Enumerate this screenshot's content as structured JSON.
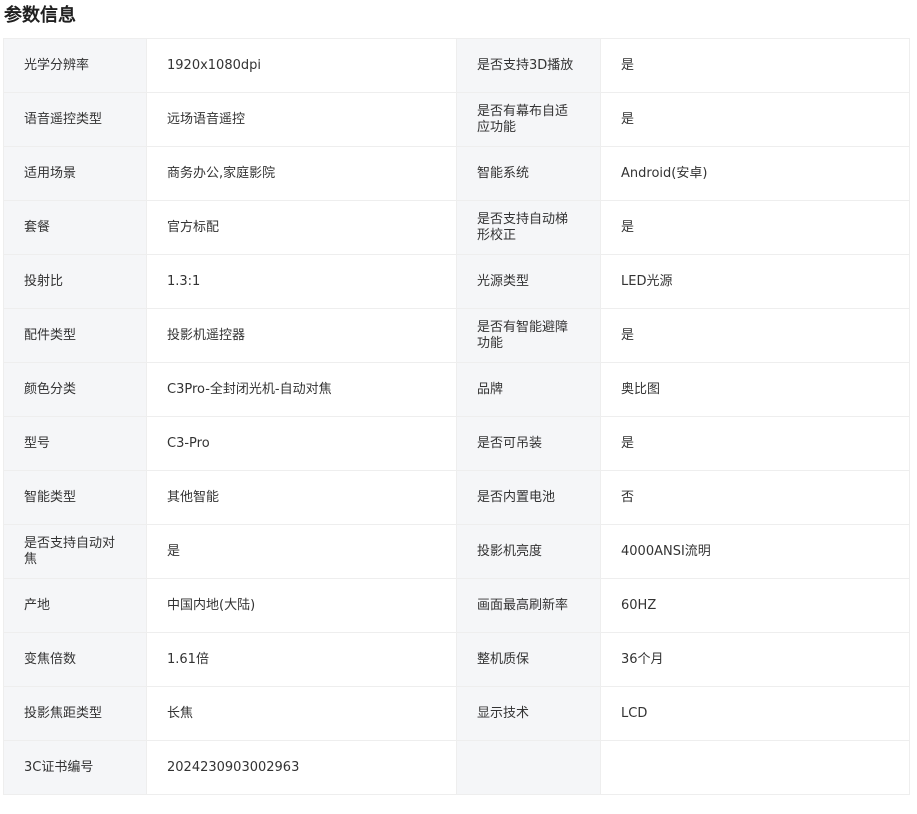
{
  "section": {
    "title": "参数信息"
  },
  "rows": [
    {
      "l_label": "光学分辨率",
      "l_value": "1920x1080dpi",
      "r_label": "是否支持3D播放",
      "r_value": "是"
    },
    {
      "l_label": "语音遥控类型",
      "l_value": "远场语音遥控",
      "r_label": "是否有幕布自适应功能",
      "r_value": "是"
    },
    {
      "l_label": "适用场景",
      "l_value": "商务办公,家庭影院",
      "r_label": "智能系统",
      "r_value": "Android(安卓)"
    },
    {
      "l_label": "套餐",
      "l_value": "官方标配",
      "r_label": "是否支持自动梯形校正",
      "r_value": "是"
    },
    {
      "l_label": "投射比",
      "l_value": "1.3:1",
      "r_label": "光源类型",
      "r_value": "LED光源"
    },
    {
      "l_label": "配件类型",
      "l_value": "投影机遥控器",
      "r_label": "是否有智能避障功能",
      "r_value": "是"
    },
    {
      "l_label": "颜色分类",
      "l_value": "C3Pro-全封闭光机-自动对焦",
      "r_label": "品牌",
      "r_value": "奥比图"
    },
    {
      "l_label": "型号",
      "l_value": "C3-Pro",
      "r_label": "是否可吊装",
      "r_value": "是"
    },
    {
      "l_label": "智能类型",
      "l_value": "其他智能",
      "r_label": "是否内置电池",
      "r_value": "否"
    },
    {
      "l_label": "是否支持自动对焦",
      "l_value": "是",
      "r_label": "投影机亮度",
      "r_value": "4000ANSI流明"
    },
    {
      "l_label": "产地",
      "l_value": "中国内地(大陆)",
      "r_label": "画面最高刷新率",
      "r_value": "60HZ"
    },
    {
      "l_label": "变焦倍数",
      "l_value": "1.61倍",
      "r_label": "整机质保",
      "r_value": "36个月"
    },
    {
      "l_label": "投影焦距类型",
      "l_value": "长焦",
      "r_label": "显示技术",
      "r_value": "LCD"
    },
    {
      "l_label": "3C证书编号",
      "l_value": "2024230903002963",
      "r_label": "",
      "r_value": ""
    }
  ]
}
